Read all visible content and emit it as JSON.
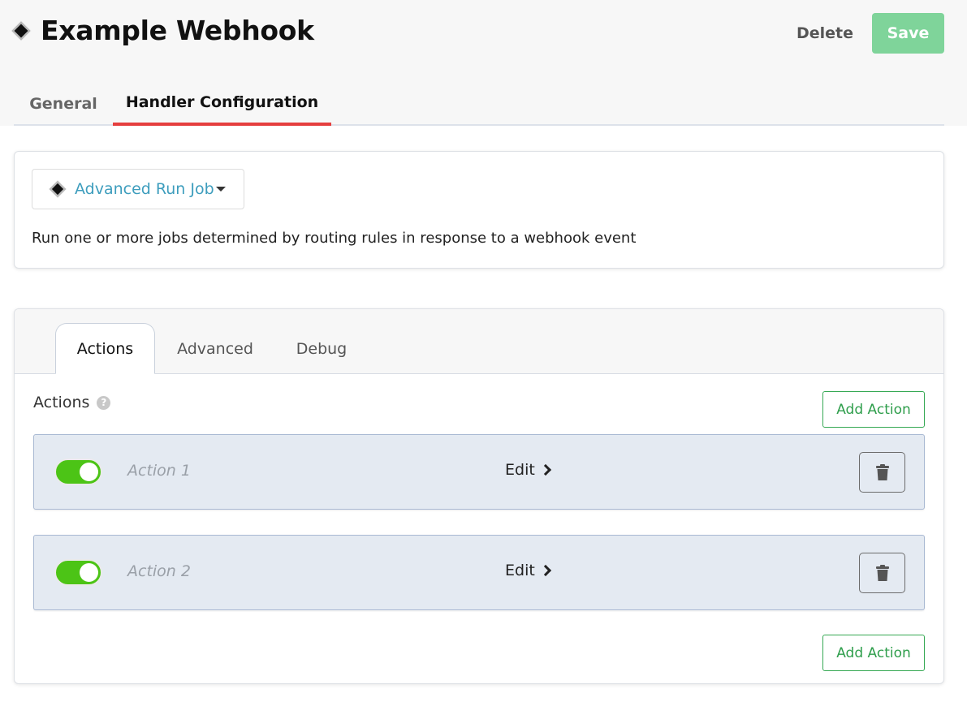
{
  "header": {
    "title": "Example Webhook",
    "icon": "diamond-icon",
    "delete_label": "Delete",
    "save_label": "Save"
  },
  "top_tabs": [
    {
      "label": "General",
      "active": false
    },
    {
      "label": "Handler Configuration",
      "active": true
    }
  ],
  "handler": {
    "selected": "Advanced Run Job",
    "description": "Run one or more jobs determined by routing rules in response to a webhook event"
  },
  "sub_tabs": [
    {
      "label": "Actions",
      "active": true
    },
    {
      "label": "Advanced",
      "active": false
    },
    {
      "label": "Debug",
      "active": false
    }
  ],
  "actions_section": {
    "label": "Actions",
    "help_icon": "question-circle-icon",
    "add_label": "Add Action",
    "items": [
      {
        "name": "Action 1",
        "enabled": true,
        "edit_label": "Edit"
      },
      {
        "name": "Action 2",
        "enabled": true,
        "edit_label": "Edit"
      }
    ]
  },
  "colors": {
    "save": "#7fd49a",
    "active_tab_underline": "#e53e3e",
    "toggle_on": "#4cc416",
    "link": "#3d9dbd",
    "add_action": "#2f9e4c"
  }
}
